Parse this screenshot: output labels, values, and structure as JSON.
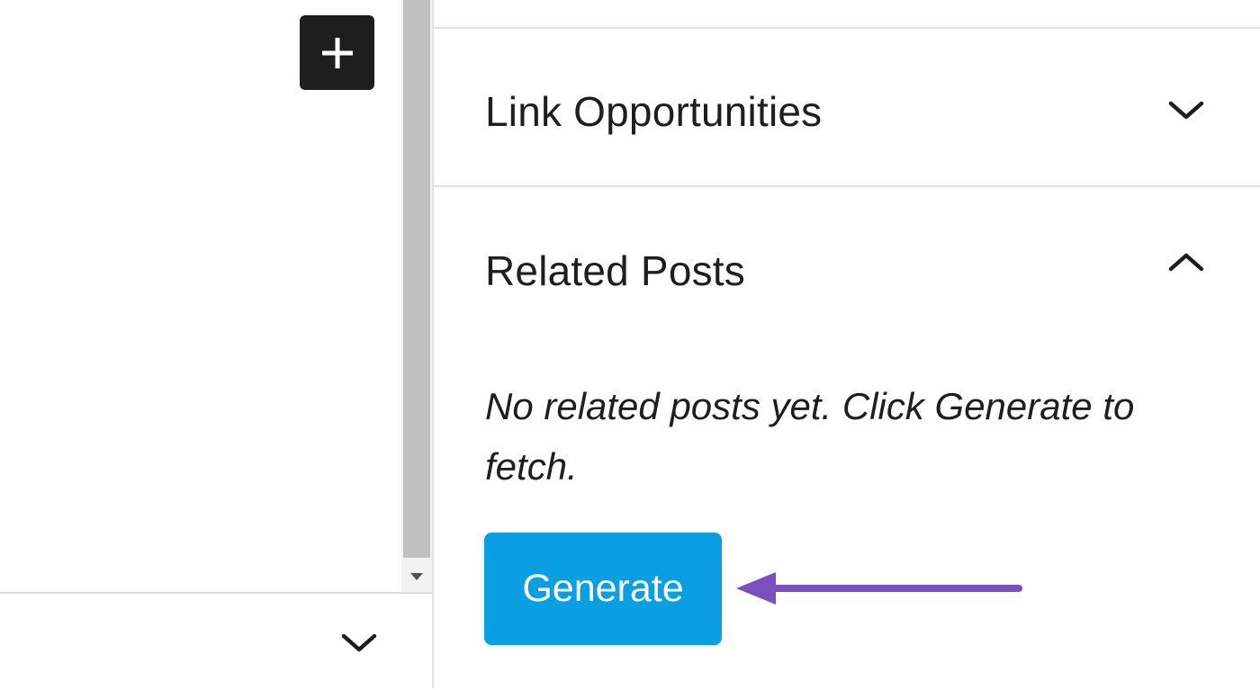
{
  "editor": {
    "inserter_icon": "plus-icon",
    "scroll_down_icon": "triangle-down-icon",
    "bottom_panel_toggle_icon": "chevron-down-icon"
  },
  "sidebar": {
    "panels": [
      {
        "title": "Link Opportunities",
        "toggle_icon": "chevron-down-icon",
        "expanded": false
      },
      {
        "title": "Related Posts",
        "toggle_icon": "chevron-up-icon",
        "expanded": true,
        "empty_message": "No related posts yet. Click Generate to fetch.",
        "generate_label": "Generate"
      }
    ]
  },
  "annotation": {
    "icon": "arrow-left-icon",
    "color": "#7b4fc0"
  },
  "colors": {
    "accent": "#0a9ee3",
    "inserter_bg": "#1e1e1e",
    "text": "#1e1e1e"
  }
}
